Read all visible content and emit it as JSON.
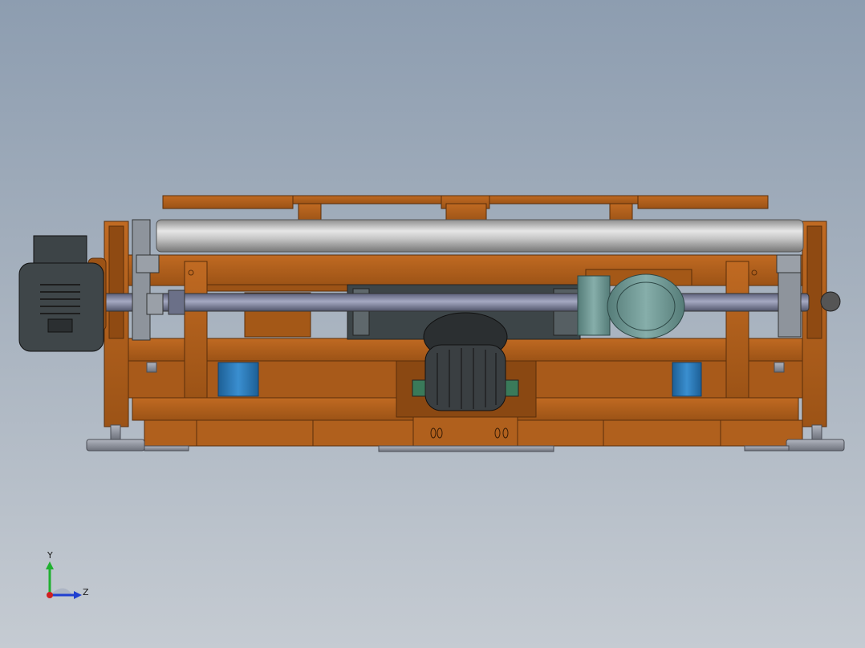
{
  "viewport": {
    "background_top": "#8d9db0",
    "background_bottom": "#c5cbd2"
  },
  "model": {
    "frame_color": "#b5621c",
    "roller_color": "#c8c8c8",
    "shaft_color": "#7a7f9a",
    "motor_dark_color": "#3e4447",
    "motor_teal_color": "#6f9894",
    "bearing_blue_color": "#2a78b8",
    "foot_color": "#8a8e98"
  },
  "triad": {
    "y_label": "Y",
    "z_label": "Z",
    "y_color": "#20b030",
    "z_color": "#2040d0",
    "x_color": "#d02020"
  }
}
